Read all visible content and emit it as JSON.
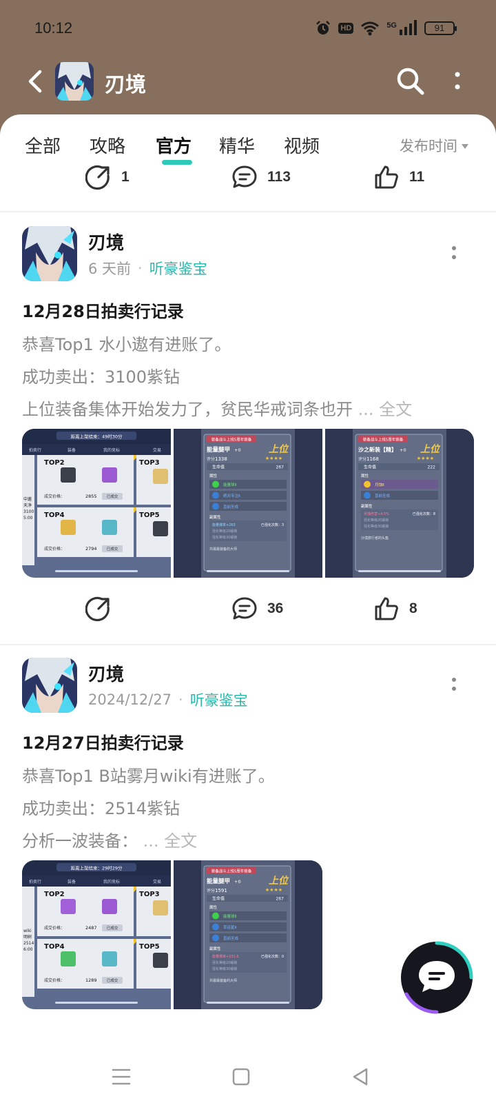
{
  "status": {
    "time": "10:12",
    "network": "5G",
    "battery": "91",
    "hd_label": "HD"
  },
  "header": {
    "title": "刃境"
  },
  "tabs": [
    {
      "label": "全部",
      "active": false
    },
    {
      "label": "攻略",
      "active": false
    },
    {
      "label": "官方",
      "active": true
    },
    {
      "label": "精华",
      "active": false
    },
    {
      "label": "视频",
      "active": false
    }
  ],
  "sort": {
    "label": "发布时间"
  },
  "top_actions": {
    "share": "1",
    "comments": "113",
    "likes": "11"
  },
  "posts": [
    {
      "author": "刃境",
      "time": "6 天前",
      "tag": "听豪鉴宝",
      "title": "12月28日拍卖行记录",
      "lines": [
        "恭喜Top1 水小遨有进账了。",
        "成功卖出：3100紫钻",
        "上位装备集体开始发力了，贫民华戒词条也开"
      ],
      "ellipsis": "...",
      "full_text": "全文",
      "actions": {
        "share": "",
        "comments": "36",
        "likes": "8"
      },
      "thumbs": [
        {
          "banner": "距离上架结束：49时30分",
          "tabs": [
            "拍卖行",
            "装备",
            "我的竞标",
            "交易"
          ],
          "cards": [
            {
              "rank": "TOP2",
              "label": "成交价格：",
              "price": "2855",
              "btn": "已成交"
            },
            {
              "rank": "TOP3"
            },
            {
              "rank": "TOP4",
              "label": "成交价格：",
              "price": "2794",
              "btn": "已成交"
            },
            {
              "rank": "TOP5"
            }
          ],
          "side_text": [
            "中遨",
            "天净",
            "3100",
            "5:00"
          ]
        },
        {
          "header": "装备战斗上线5周年装备",
          "name": "能量腿甲",
          "level": "+0",
          "rank": "上位",
          "score_label": "评分",
          "score": "1338",
          "hp_label": "生命值",
          "hp": "267",
          "section1": "属性",
          "skills": [
            "能量球Ⅱ",
            "绝对专注Ⅱ",
            "直前至成"
          ],
          "section2": "副属性",
          "sub": [
            "能量爆率+263",
            "强化等级20解锁",
            "强化等级30解锁"
          ],
          "bottom": "共最最装备的大师",
          "extra": "已强化次数：3"
        },
        {
          "header": "装备战斗上线5周年装备",
          "name": "沙之新装【精】",
          "level": "+0",
          "rank": "上位",
          "score_label": "评分",
          "score": "1168",
          "hp_label": "生命值",
          "hp": "222",
          "section1": "属性",
          "skills": [
            "月蚀Ⅱ",
            "直前至成"
          ],
          "section2": "副属性",
          "sub": [
            "月蚀伤害+4.5%",
            "强化等级20解锁",
            "强化等级30解锁"
          ],
          "bottom": "沙漠旅行者的头盔",
          "extra": "已强化次数：8"
        }
      ]
    },
    {
      "author": "刃境",
      "time": "2024/12/27",
      "tag": "听豪鉴宝",
      "title": "12月27日拍卖行记录",
      "lines": [
        "恭喜Top1 B站雾月wiki有进账了。",
        "成功卖出：2514紫钻",
        "分析一波装备："
      ],
      "ellipsis": "...",
      "full_text": "全文",
      "thumbs": [
        {
          "banner": "距离上架结束：29时29分",
          "tabs": [
            "拍卖行",
            "装备",
            "我的竞标",
            "交易"
          ],
          "cards": [
            {
              "rank": "TOP2",
              "label": "成交价格：",
              "price": "2487",
              "btn": "已成交"
            },
            {
              "rank": "TOP3"
            },
            {
              "rank": "TOP4",
              "label": "成交价格：",
              "price": "1289",
              "btn": "已成交"
            },
            {
              "rank": "TOP5"
            }
          ],
          "side_text": [
            "wiki",
            "明树",
            "2514",
            "6:00"
          ]
        },
        {
          "header": "装备战斗上线5周年装备",
          "name": "能量腿甲",
          "level": "+0",
          "rank": "上位",
          "score_label": "评分",
          "score": "1591",
          "hp_label": "生命值",
          "hp": "267",
          "section1": "属性",
          "skills": [
            "能量球Ⅱ",
            "幸运星Ⅱ",
            "直前至成"
          ],
          "section2": "副属性",
          "sub": [
            "能量爆率+231.6",
            "强化等级20解锁",
            "强化等级30解锁"
          ],
          "bottom": "共最最装备的大师",
          "extra": "已强化次数：0"
        }
      ]
    }
  ],
  "colors": {
    "brown": "#86705d",
    "teal": "#2ab9ad",
    "gray_text": "#8b8b8b"
  }
}
